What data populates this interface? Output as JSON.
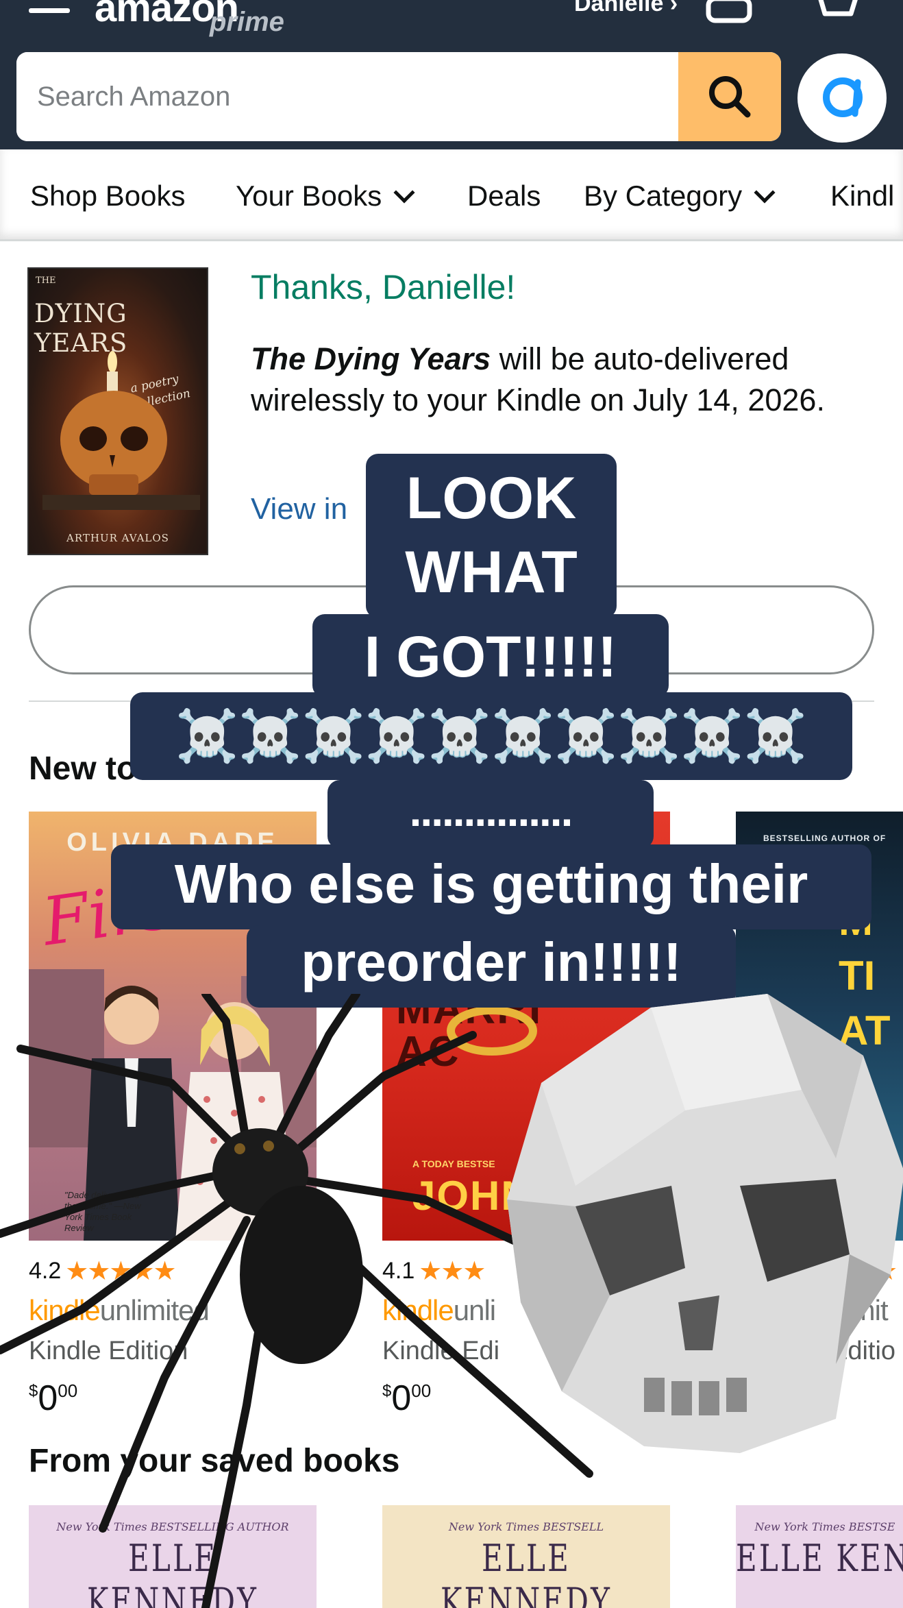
{
  "header": {
    "logo_text": "amazon",
    "logo_sub": "prime",
    "account_label": "Danielle ›",
    "search_placeholder": "Search Amazon"
  },
  "nav": {
    "items": [
      {
        "label": "Shop Books"
      },
      {
        "label": "Your Books"
      },
      {
        "label": "Deals"
      },
      {
        "label": "By Category"
      },
      {
        "label": "Kindl"
      }
    ]
  },
  "confirmation": {
    "cover": {
      "top": "THE",
      "title": "DYING YEARS",
      "subtitle": "a poetry collection",
      "author": "ARTHUR AVALOS"
    },
    "thanks": "Thanks, Danielle!",
    "book_title": "The Dying Years",
    "delivery_text": " will be auto-delivered wirelessly to your Kindle on July 14, 2026.",
    "view_link": "View in",
    "button_label": ""
  },
  "new_releases": {
    "heading": "New to",
    "books": [
      {
        "cover_author": "OLIVIA DADE",
        "cover_title": "First",
        "cover_quote": "\"Dade delivers and then some.\" —New York Times Book Review",
        "rating": "4.2",
        "stars": "★★★★★",
        "ku_k": "kindle",
        "ku_u": "unlimited",
        "edition": "Kindle Edition",
        "price_dollars": "0",
        "price_cents": "00"
      },
      {
        "cover_title": "MARRI AC",
        "cover_banner": "A TODAY BESTSE",
        "cover_author": "JOHN",
        "rating": "4.1",
        "stars": "★★★",
        "ku_k": "kindle",
        "ku_u": "unli",
        "edition": "Kindle Edi",
        "price_dollars": "0",
        "price_cents": "00"
      },
      {
        "cover_top": "BESTSELLING AUTHOR OF",
        "cover_letters": "M TI AT",
        "rating": "",
        "stars": "★",
        "ku_k": "",
        "ku_u": "limit",
        "edition": "Editio",
        "price_dollars": "",
        "price_cents": ""
      }
    ]
  },
  "saved_books": {
    "heading": "From your saved books",
    "books": [
      {
        "tag": "New York Times BESTSELLING AUTHOR",
        "author": "ELLE KENNEDY"
      },
      {
        "tag": "New York Times BESTSELL",
        "author": "ELLE KENNEDY"
      },
      {
        "tag": "New York Times BESTSE",
        "author": "ELLE KEN"
      }
    ]
  },
  "overlay_text": {
    "line1": "LOOK",
    "line2": "WHAT",
    "line3": "I GOT!!!!!",
    "skulls": "☠️☠️☠️☠️☠️☠️☠️☠️☠️☠️",
    "dots": "...............",
    "line4": "Who else is getting their",
    "line5": "preorder in!!!!!"
  },
  "colors": {
    "header_bg": "#232f3e",
    "search_button": "#febd69",
    "thanks_green": "#067d62",
    "link_blue": "#2162a1",
    "overlay_bg": "#233250",
    "star_orange": "#ff8c14",
    "kindle_orange": "#ff9900"
  },
  "icons": [
    "menu-icon",
    "user-icon",
    "cart-icon",
    "search-icon",
    "alexa-icon",
    "chevron-down-icon",
    "skull-icon",
    "spider-sticker",
    "skull-sticker"
  ]
}
